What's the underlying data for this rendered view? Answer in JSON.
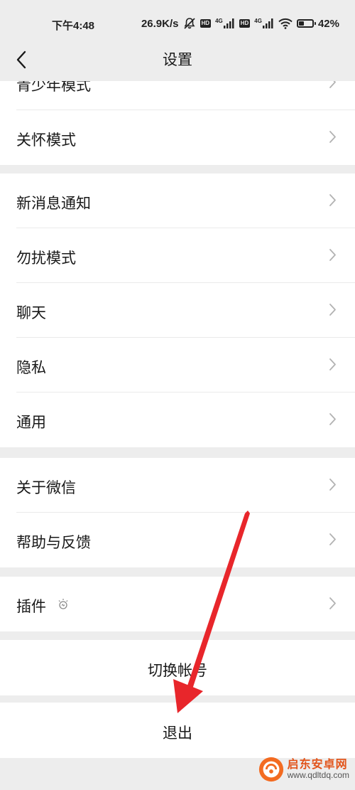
{
  "status_bar": {
    "time": "下午4:48",
    "network_speed": "26.9K/s",
    "hd1": "HD",
    "net1": "4G",
    "hd2": "HD",
    "net2": "4G",
    "battery": "42%",
    "battery_level": 0.42
  },
  "nav": {
    "title": "设置"
  },
  "groups": {
    "g1": {
      "partial": "青少年模式",
      "care_mode": "关怀模式"
    },
    "g2": {
      "notifications": "新消息通知",
      "dnd": "勿扰模式",
      "chat": "聊天",
      "privacy": "隐私",
      "general": "通用"
    },
    "g3": {
      "about": "关于微信",
      "help": "帮助与反馈"
    },
    "g4": {
      "plugins": "插件"
    }
  },
  "actions": {
    "switch_account": "切换帐号",
    "logout": "退出"
  },
  "watermark": {
    "title": "启东安卓网",
    "url": "www.qdltdq.com"
  },
  "colors": {
    "background": "#ededed",
    "cell": "#ffffff",
    "text": "#191919",
    "chevron": "#b2b2b2",
    "arrow": "#e8262b"
  }
}
